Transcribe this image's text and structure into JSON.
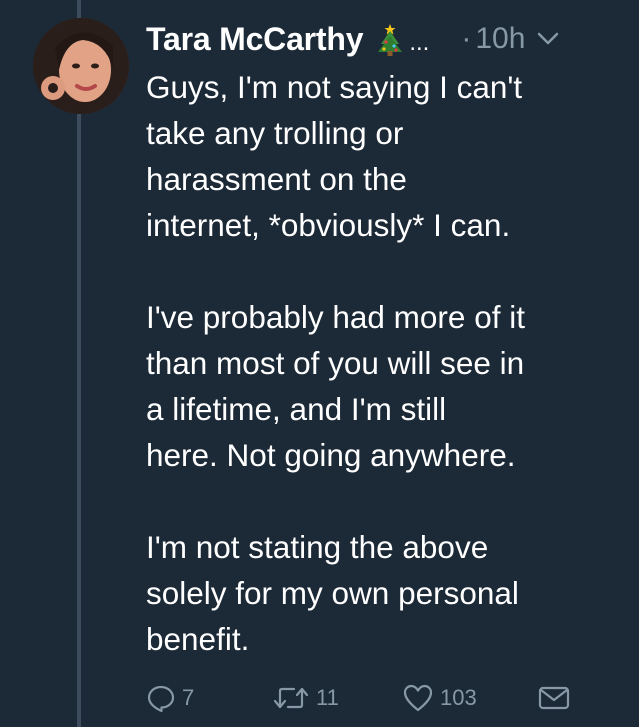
{
  "tweet": {
    "author_name": "Tara McCarthy",
    "author_badge_icon": "christmas-tree-icon",
    "name_overflow": "...",
    "time_separator": "·",
    "timestamp": "10h",
    "text": "Guys, I'm not saying I can't\ntake any trolling or\nharassment on the\ninternet, *obviously* I can.\n\nI've probably had more of it\nthan most of you will see in\na lifetime, and I'm still\nhere. Not going anywhere.\n\nI'm not stating the above\nsolely for my own personal\nbenefit.",
    "replies": "7",
    "retweets": "11",
    "likes": "103"
  },
  "colors": {
    "background": "#1c2937",
    "text": "#ffffff",
    "muted": "#8899a6",
    "thread_line": "#3e4d5e"
  }
}
